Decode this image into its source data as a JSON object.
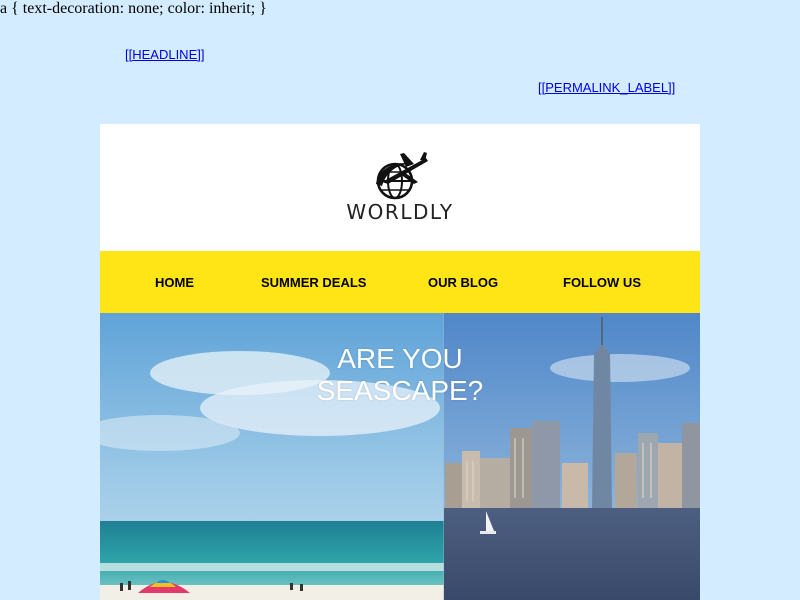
{
  "stray_css_text": "a { text-decoration: none; color: inherit; }",
  "preheader": {
    "headline_link": "[[HEADLINE]]",
    "permalink_link": "[[PERMALINK_LABEL]]"
  },
  "brand": {
    "logo_icon": "globe-with-airplane-icon",
    "name": "WORLDLY"
  },
  "nav": {
    "items": [
      {
        "label": "HOME"
      },
      {
        "label": "SUMMER DEALS"
      },
      {
        "label": "OUR BLOG"
      },
      {
        "label": "FOLLOW US"
      }
    ]
  },
  "hero": {
    "title_line1": "ARE YOU",
    "title_line2": "SEASCAPE?"
  },
  "colors": {
    "page_background": "#d3ecff",
    "nav_background": "#ffe516",
    "link": "#0000ee"
  }
}
